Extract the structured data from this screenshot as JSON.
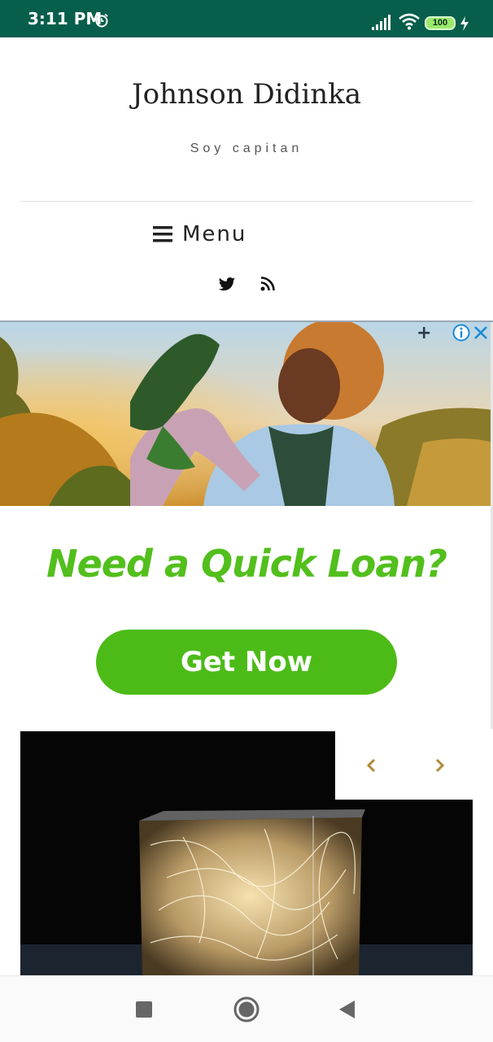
{
  "status_bar": {
    "time": "3:11 PM",
    "battery": "100",
    "icons": [
      "alarm-icon",
      "signal-icon",
      "wifi-icon",
      "battery-icon",
      "charging-icon"
    ]
  },
  "site": {
    "title": "Johnson Didinka",
    "description": "Soy capitan"
  },
  "menu": {
    "label": "Menu",
    "icon": "hamburger-icon"
  },
  "social": [
    "twitter-icon",
    "rss-icon"
  ],
  "ad": {
    "headline": "Need a Quick Loan?",
    "cta": "Get Now",
    "corner_mark": "+",
    "icons": [
      "info-icon",
      "close-icon"
    ],
    "accent_color": "#4cbb17"
  },
  "slider": {
    "icons": [
      "chevron-left-icon",
      "chevron-right-icon"
    ],
    "arrow_color": "#b08a3c"
  },
  "nav_bar": {
    "icons": [
      "recent-apps-icon",
      "home-icon",
      "back-icon"
    ]
  }
}
